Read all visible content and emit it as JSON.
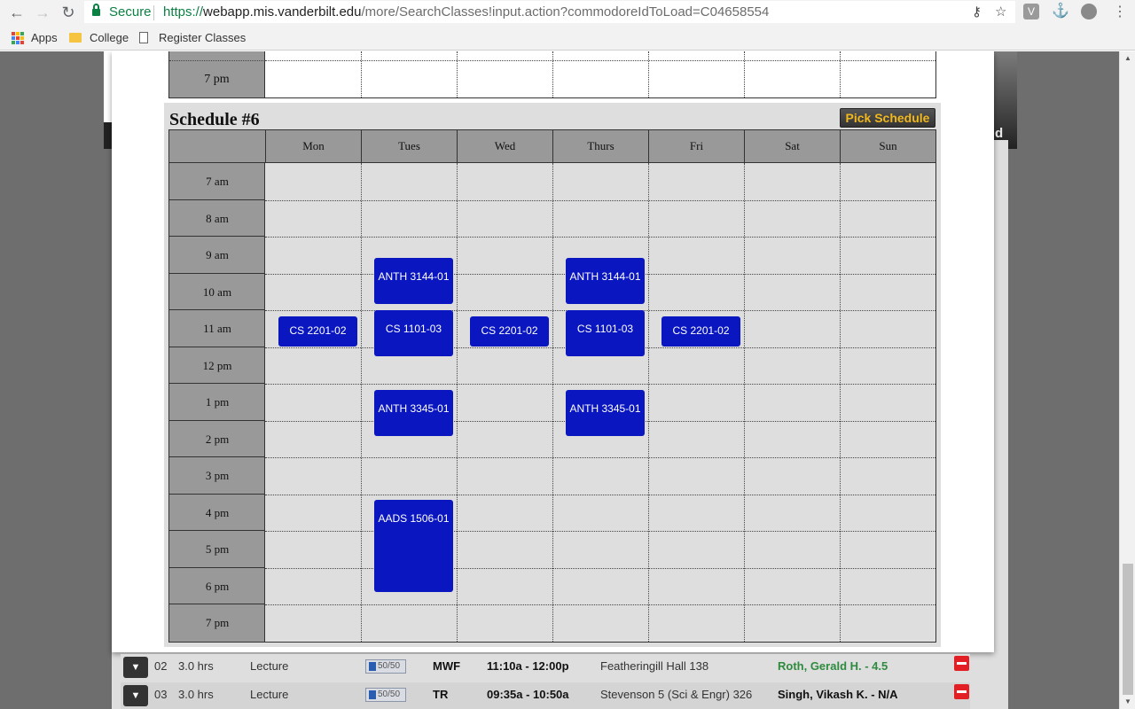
{
  "browser": {
    "secure_label": "Secure",
    "url_protocol": "https://",
    "url_host": "webapp.mis.vanderbilt.edu",
    "url_path": "/more/SearchClasses!input.action?commodoreIdToLoad=C04658554",
    "bookmarks": [
      "Apps",
      "College",
      "Register Classes"
    ],
    "extensions": [
      "V"
    ]
  },
  "background_panel": {
    "partial_text": "d"
  },
  "previous_schedule": {
    "last_time": "7 pm"
  },
  "schedule": {
    "title": "Schedule #6",
    "pick_button": "Pick Schedule",
    "days": [
      "Mon",
      "Tues",
      "Wed",
      "Thurs",
      "Fri",
      "Sat",
      "Sun"
    ],
    "times": [
      "7 am",
      "8 am",
      "9 am",
      "10 am",
      "11 am",
      "12 pm",
      "1 pm",
      "2 pm",
      "3 pm",
      "4 pm",
      "5 pm",
      "6 pm",
      "7 pm"
    ],
    "courses": [
      {
        "label": "ANTH 3144-01",
        "day": "Tues",
        "start": "9:35a",
        "end": "10:50a"
      },
      {
        "label": "ANTH 3144-01",
        "day": "Thurs",
        "start": "9:35a",
        "end": "10:50a"
      },
      {
        "label": "CS 2201-02",
        "day": "Mon",
        "start": "11:10a",
        "end": "12:00p"
      },
      {
        "label": "CS 1101-03",
        "day": "Tues",
        "start": "11:00a",
        "end": "12:15p"
      },
      {
        "label": "CS 2201-02",
        "day": "Wed",
        "start": "11:10a",
        "end": "12:00p"
      },
      {
        "label": "CS 1101-03",
        "day": "Thurs",
        "start": "11:00a",
        "end": "12:15p"
      },
      {
        "label": "CS 2201-02",
        "day": "Fri",
        "start": "11:10a",
        "end": "12:00p"
      },
      {
        "label": "ANTH 3345-01",
        "day": "Tues",
        "start": "1:10p",
        "end": "2:25p"
      },
      {
        "label": "ANTH 3345-01",
        "day": "Thurs",
        "start": "1:10p",
        "end": "2:25p"
      },
      {
        "label": "AADS 1506-01",
        "day": "Tues",
        "start": "4:10p",
        "end": "6:40p"
      }
    ]
  },
  "class_rows": [
    {
      "section": "02",
      "hours": "3.0 hrs",
      "type": "Lecture",
      "seats": "50/50",
      "days": "MWF",
      "time": "11:10a - 12:00p",
      "location": "Featheringill Hall 138",
      "instructor": "Roth, Gerald H. - 4.5"
    },
    {
      "section": "03",
      "hours": "3.0 hrs",
      "type": "Lecture",
      "seats": "50/50",
      "days": "TR",
      "time": "09:35a - 10:50a",
      "location": "Stevenson 5 (Sci & Engr) 326",
      "instructor": "Singh, Vikash K. - N/A"
    }
  ],
  "colors": {
    "course_block": "#0a16c0",
    "pick_button_text": "#f1b81d",
    "grid_bg": "#dedede",
    "header_bg": "#999999",
    "instructor_rated": "#2e8b3e",
    "remove_button": "#e31f26"
  }
}
